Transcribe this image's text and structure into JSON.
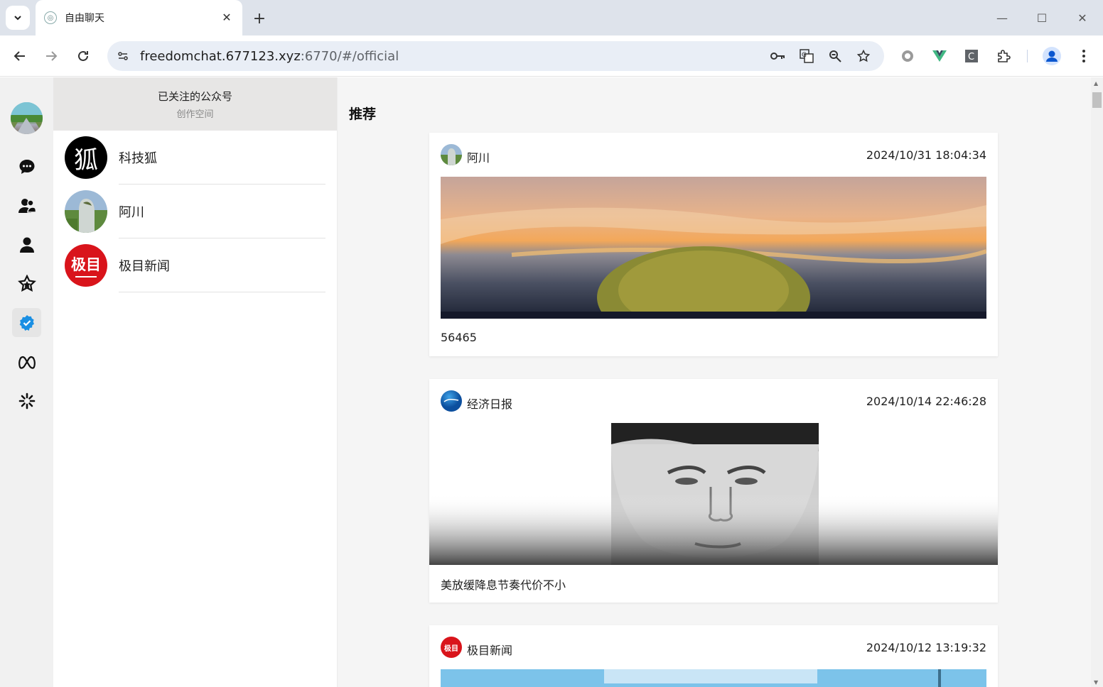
{
  "browser": {
    "tab_title": "自由聊天",
    "url_host": "freedomchat.677123.xyz",
    "url_rest": ":6770/#/official"
  },
  "sidebar": {
    "icons": [
      "chat-icon",
      "contacts-icon",
      "profile-icon",
      "favorites-icon",
      "official-verified-icon",
      "meta-icon",
      "sparkle-icon"
    ],
    "active": "official-verified-icon",
    "accent_color": "#1a8fe3"
  },
  "followed_panel": {
    "title": "已关注的公众号",
    "subtitle": "创作空间",
    "accounts": [
      {
        "name": "科技狐",
        "avatar_text": "狐"
      },
      {
        "name": "阿川",
        "avatar_text": ""
      },
      {
        "name": "极目新闻",
        "avatar_text": "极目"
      }
    ]
  },
  "feed": {
    "heading": "推荐",
    "posts": [
      {
        "author": "阿川",
        "time": "2024/10/31 18:04:34",
        "text": "56465"
      },
      {
        "author": "经济日报",
        "time": "2024/10/14 22:46:28",
        "text": "美放缓降息节奏代价不小"
      },
      {
        "author": "极目新闻",
        "time": "2024/10/12 13:19:32",
        "text": ""
      }
    ]
  }
}
